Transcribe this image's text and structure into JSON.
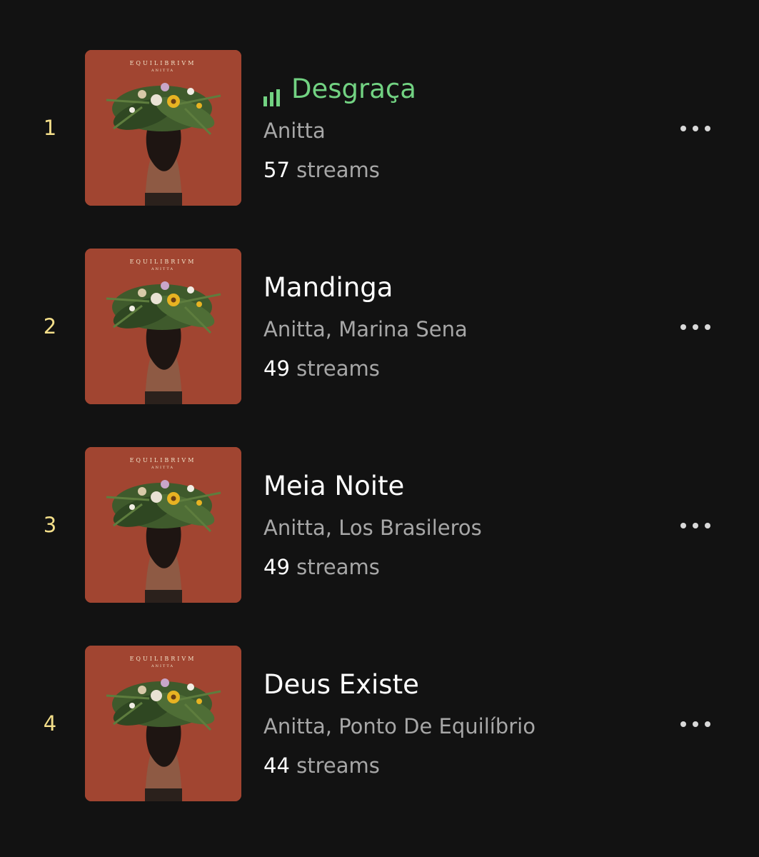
{
  "accent_color": "#72d282",
  "rank_color": "#f4df8a",
  "cover_art": {
    "header_text": "EQUILIBRIVM",
    "sub_text": "ANITTA",
    "background_color": "#a94a34"
  },
  "tracks": [
    {
      "rank": "1",
      "title": "Desgraça",
      "artists": "Anitta",
      "streams_count": "57",
      "streams_label": "streams",
      "now_playing": true,
      "playing_icon": "equalizer-bars-icon",
      "more_icon": "more-options-icon"
    },
    {
      "rank": "2",
      "title": "Mandinga",
      "artists": "Anitta, Marina Sena",
      "streams_count": "49",
      "streams_label": "streams",
      "now_playing": false,
      "more_icon": "more-options-icon"
    },
    {
      "rank": "3",
      "title": "Meia Noite",
      "artists": "Anitta, Los Brasileros",
      "streams_count": "49",
      "streams_label": "streams",
      "now_playing": false,
      "more_icon": "more-options-icon"
    },
    {
      "rank": "4",
      "title": "Deus Existe",
      "artists": "Anitta, Ponto De Equilíbrio",
      "streams_count": "44",
      "streams_label": "streams",
      "now_playing": false,
      "more_icon": "more-options-icon"
    }
  ]
}
